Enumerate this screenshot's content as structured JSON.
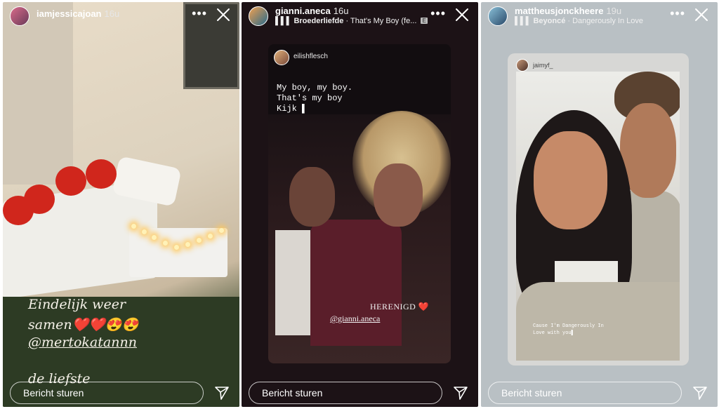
{
  "stories": [
    {
      "username": "iamjessicajoan",
      "time": "16u",
      "more_icon": "•••",
      "overlay_lines": [
        "Eindelijk weer",
        "samen❤️❤️😍😍",
        "@mertokatannn",
        "de liefste"
      ],
      "message_placeholder": "Bericht sturen"
    },
    {
      "username": "gianni.aneca",
      "time": "16u",
      "music_artist": "Broederliefde",
      "music_song": "That's My Boy (fe...",
      "explicit_badge": "E",
      "more_icon": "•••",
      "repost_username": "eilishflesch",
      "typed_text": "My boy, my boy.\nThat's my boy\nKijk ▌",
      "sticker_text": "HERENIGD ❤️",
      "mention_text": "@gianni.aneca",
      "message_placeholder": "Bericht sturen"
    },
    {
      "username": "mattheusjonckheere",
      "time": "19u",
      "music_artist": "Beyoncé",
      "music_song": "Dangerously In Love",
      "more_icon": "•••",
      "repost_username": "jaimyf_",
      "caption_text": "Cause I'm Dangerously In Love with you▌",
      "message_placeholder": "Bericht sturen"
    }
  ]
}
